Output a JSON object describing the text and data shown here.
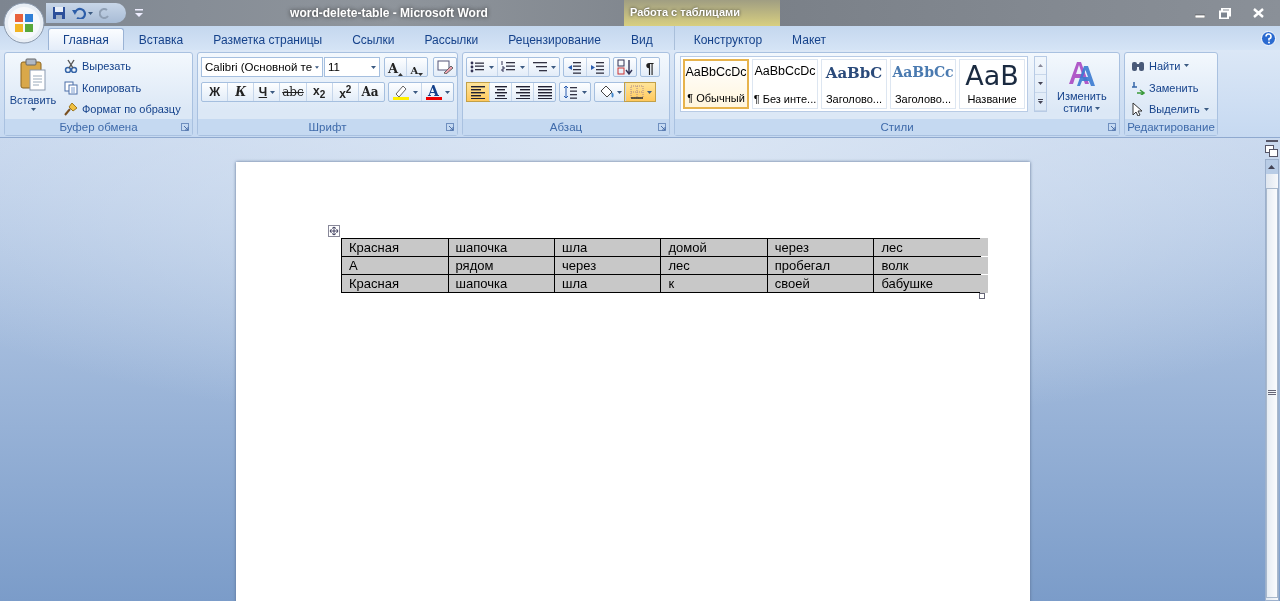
{
  "window": {
    "title": "word-delete-table  -  Microsoft Word",
    "context_title": "Работа с таблицами"
  },
  "tabs": [
    {
      "label": "Главная",
      "selected": true,
      "kind": "main"
    },
    {
      "label": "Вставка",
      "selected": false,
      "kind": "main"
    },
    {
      "label": "Разметка страницы",
      "selected": false,
      "kind": "main"
    },
    {
      "label": "Ссылки",
      "selected": false,
      "kind": "main"
    },
    {
      "label": "Рассылки",
      "selected": false,
      "kind": "main"
    },
    {
      "label": "Рецензирование",
      "selected": false,
      "kind": "main"
    },
    {
      "label": "Вид",
      "selected": false,
      "kind": "main"
    },
    {
      "label": "Конструктор",
      "selected": false,
      "kind": "context"
    },
    {
      "label": "Макет",
      "selected": false,
      "kind": "context"
    }
  ],
  "ribbon": {
    "clipboard": {
      "label": "Буфер обмена",
      "paste": "Вставить",
      "items": [
        {
          "kind": "cut",
          "label": "Вырезать"
        },
        {
          "kind": "copy",
          "label": "Копировать"
        },
        {
          "kind": "painter",
          "label": "Формат по образцу"
        }
      ]
    },
    "font": {
      "label": "Шрифт",
      "font_name": "Calibri (Основной те",
      "font_size": "11",
      "size_buttons": [
        {
          "kind": "grow",
          "text": "A"
        },
        {
          "kind": "shrink",
          "text": "A"
        }
      ],
      "formatting": [
        {
          "kind": "bold",
          "text": "Ж"
        },
        {
          "kind": "italic",
          "text": "К"
        },
        {
          "kind": "underline",
          "text": "Ч"
        },
        {
          "kind": "strike",
          "text": "abc"
        },
        {
          "kind": "subscript",
          "text": "x$_{2}$"
        },
        {
          "kind": "superscript",
          "text": "x$^{2}$"
        },
        {
          "kind": "case",
          "text": "Aa"
        }
      ],
      "font_color": "A"
    },
    "paragraph": {
      "label": "Абзац",
      "pilcrow": "¶",
      "alignment": [
        {
          "kind": "left",
          "selected": true
        },
        {
          "kind": "center",
          "selected": false
        },
        {
          "kind": "right",
          "selected": false
        },
        {
          "kind": "justify",
          "selected": false
        }
      ]
    },
    "styles": {
      "label": "Стили",
      "items": [
        {
          "kind": "normal",
          "sample": "AaBbCcDc",
          "name": "¶ Обычный",
          "selected": true
        },
        {
          "kind": "nospacing",
          "sample": "AaBbCcDc",
          "name": "¶ Без инте...",
          "selected": false
        },
        {
          "kind": "heading1",
          "sample": "AaBbC",
          "name": "Заголово...",
          "selected": false
        },
        {
          "kind": "heading2",
          "sample": "AaBbCc",
          "name": "Заголово...",
          "selected": false
        },
        {
          "kind": "title",
          "sample": "AaB",
          "name": "Название",
          "selected": false
        }
      ],
      "change": [
        "Изменить",
        "стили"
      ]
    },
    "editing": {
      "label": "Редактирование",
      "items": [
        {
          "kind": "find",
          "label": "Найти"
        },
        {
          "kind": "replace",
          "label": "Заменить"
        },
        {
          "kind": "select",
          "label": "Выделить"
        }
      ]
    }
  },
  "table": {
    "selected": true,
    "rows": [
      [
        "Красная",
        "шапочка",
        "шла",
        "домой",
        "через",
        "лес"
      ],
      [
        "А",
        "рядом",
        "через",
        "лес",
        "пробегал",
        "волк"
      ],
      [
        "Красная",
        "шапочка",
        "шла",
        "к",
        "своей",
        "бабушке"
      ]
    ]
  }
}
